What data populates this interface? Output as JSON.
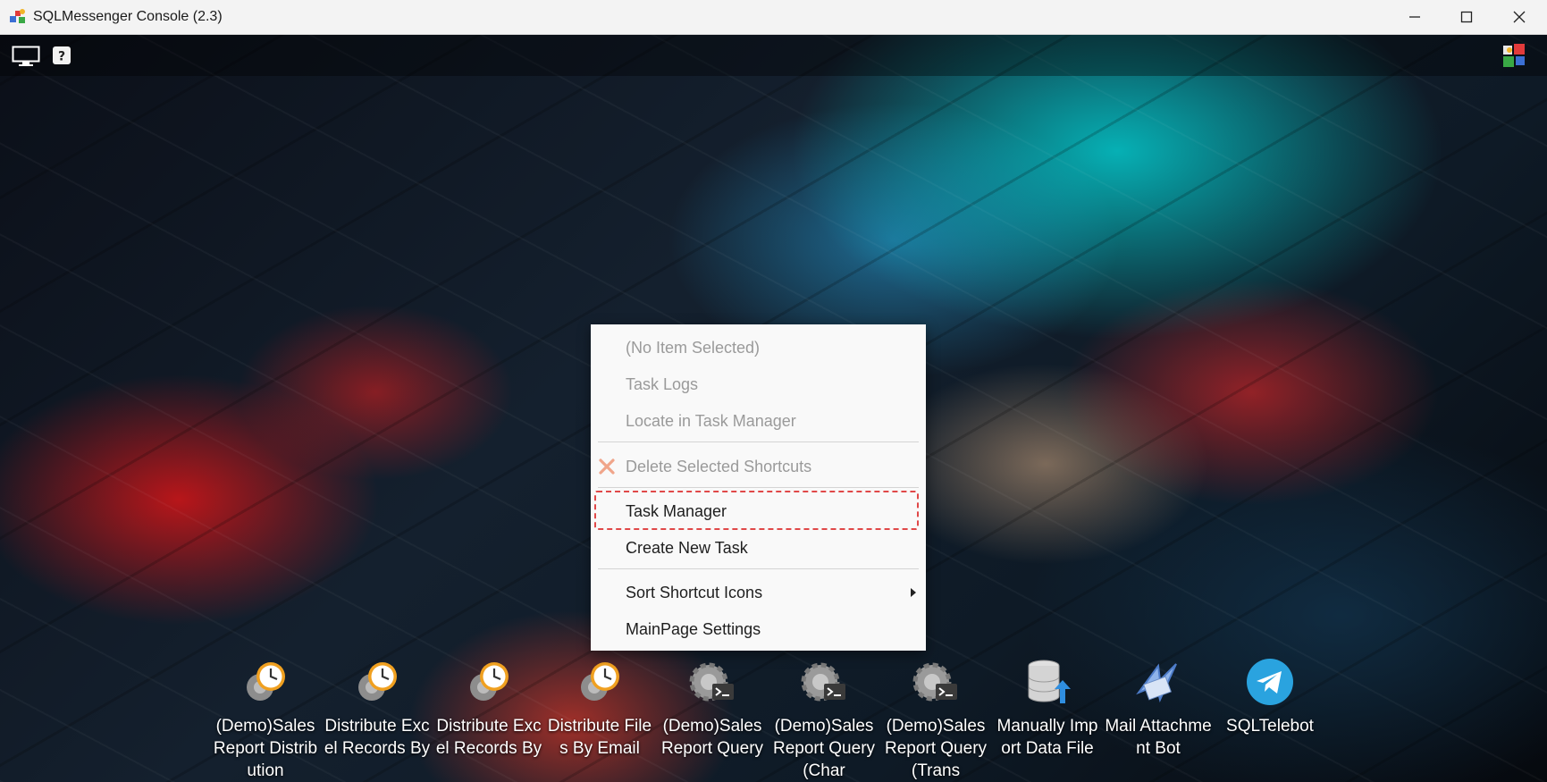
{
  "window": {
    "title": "SQLMessenger Console (2.3)"
  },
  "toolbar": {
    "left_icons": [
      "monitor-icon",
      "help-icon"
    ],
    "right_icon": "app-logo-icon"
  },
  "context_menu": {
    "items": [
      {
        "label": "(No Item Selected)",
        "enabled": false
      },
      {
        "label": "Task Logs",
        "enabled": false
      },
      {
        "label": "Locate in Task Manager",
        "enabled": false
      },
      {
        "label": "Delete Selected Shortcuts",
        "enabled": false,
        "icon": "delete-x-icon"
      },
      {
        "label": "Task Manager",
        "enabled": true,
        "highlighted": true
      },
      {
        "label": "Create New Task",
        "enabled": true
      },
      {
        "label": "Sort Shortcut Icons",
        "enabled": true,
        "submenu": true
      },
      {
        "label": "MainPage Settings",
        "enabled": true
      }
    ]
  },
  "shortcuts": [
    {
      "label": "(Demo)Sales Report Distribution",
      "icon": "scheduled-task-icon"
    },
    {
      "label": "Distribute Excel Records By",
      "icon": "scheduled-task-icon"
    },
    {
      "label": "Distribute Excel Records By",
      "icon": "scheduled-task-icon"
    },
    {
      "label": "Distribute Files By Email",
      "icon": "scheduled-task-icon"
    },
    {
      "label": "(Demo)Sales Report Query",
      "icon": "gear-console-icon"
    },
    {
      "label": "(Demo)Sales Report Query(Char",
      "icon": "gear-console-icon"
    },
    {
      "label": "(Demo)Sales Report Query(Trans",
      "icon": "gear-console-icon"
    },
    {
      "label": "Manually Import Data File",
      "icon": "database-import-icon"
    },
    {
      "label": "Mail Attachment Bot",
      "icon": "mail-bot-icon"
    },
    {
      "label": "SQLTelebot",
      "icon": "telegram-icon"
    }
  ],
  "colors": {
    "highlight_border": "#e04848",
    "menu_bg": "#f9f9f9",
    "disabled_text": "#9a9a9a"
  }
}
